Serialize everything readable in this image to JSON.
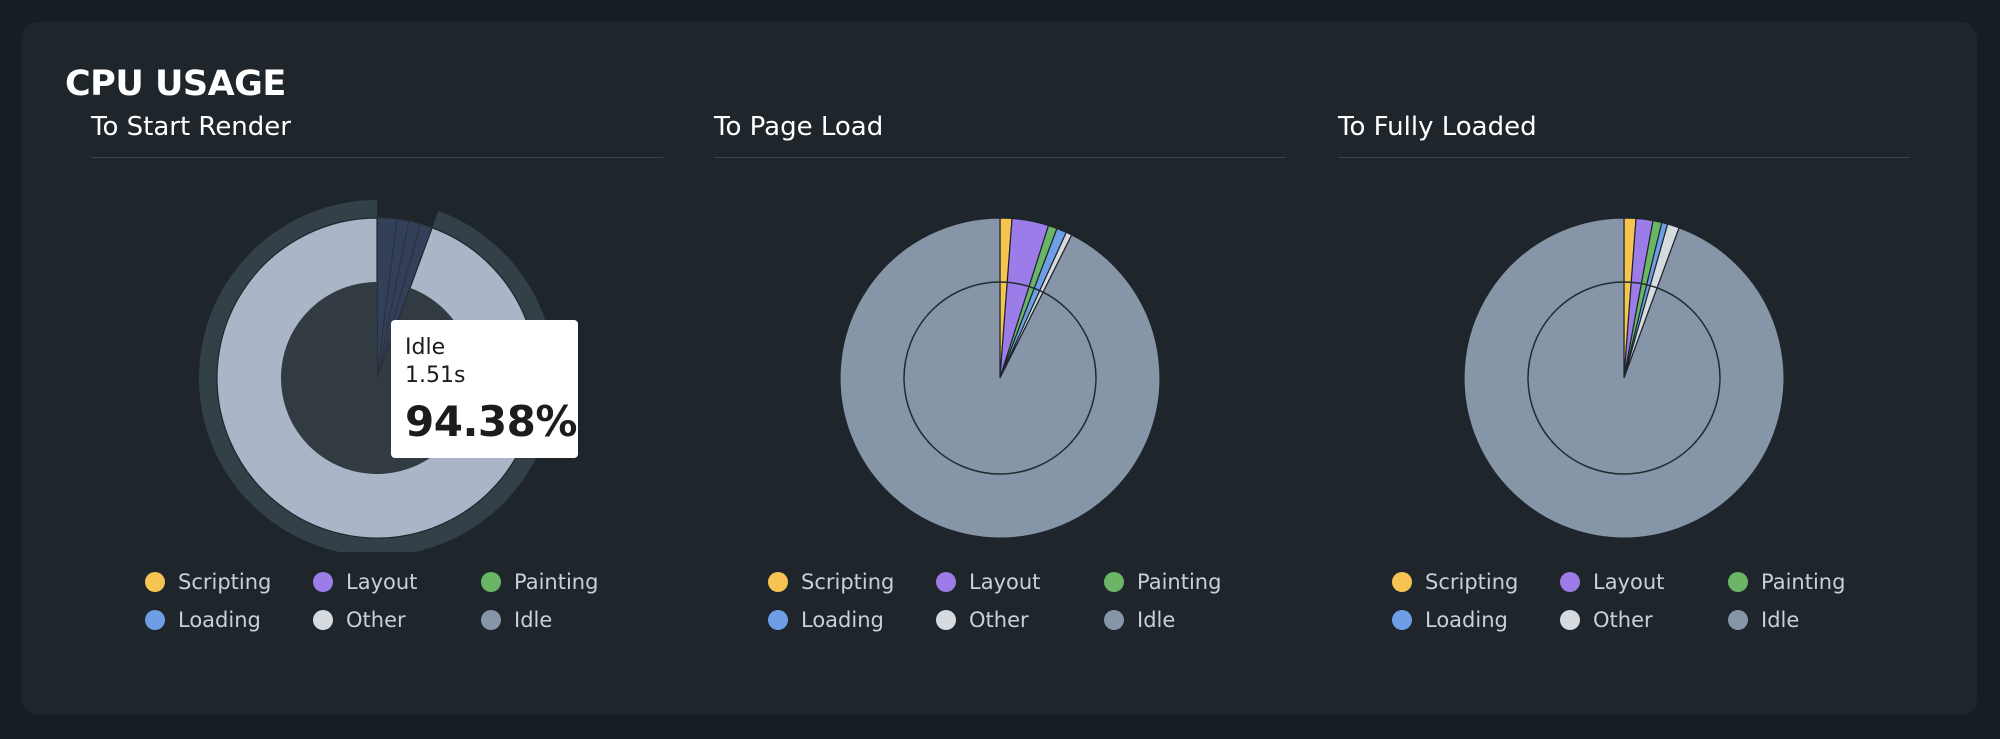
{
  "card": {
    "title": "CPU USAGE"
  },
  "legend": [
    {
      "name": "Scripting",
      "color": "#f5c451"
    },
    {
      "name": "Layout",
      "color": "#9b7ce8"
    },
    {
      "name": "Painting",
      "color": "#6bb566"
    },
    {
      "name": "Loading",
      "color": "#6e9ee6"
    },
    {
      "name": "Other",
      "color": "#d6dbe0"
    },
    {
      "name": "Idle",
      "color": "#8696a8"
    }
  ],
  "tooltip": {
    "label": "Idle",
    "time": "1.51s",
    "percent": "94.38%"
  },
  "chart_data": [
    {
      "type": "pie",
      "title": "To Start Render",
      "categories": [
        "Scripting",
        "Layout",
        "Painting",
        "Loading",
        "Other",
        "Idle"
      ],
      "values": [
        0.0,
        2.0,
        1.2,
        1.2,
        1.2,
        94.38
      ],
      "hovered": "Idle"
    },
    {
      "type": "pie",
      "title": "To Page Load",
      "categories": [
        "Scripting",
        "Layout",
        "Painting",
        "Loading",
        "Other",
        "Idle"
      ],
      "values": [
        1.2,
        3.7,
        0.9,
        1.0,
        0.6,
        92.6
      ]
    },
    {
      "type": "pie",
      "title": "To Fully Loaded",
      "categories": [
        "Scripting",
        "Layout",
        "Painting",
        "Loading",
        "Other",
        "Idle"
      ],
      "values": [
        1.2,
        1.7,
        0.9,
        0.6,
        1.2,
        94.4
      ]
    }
  ]
}
